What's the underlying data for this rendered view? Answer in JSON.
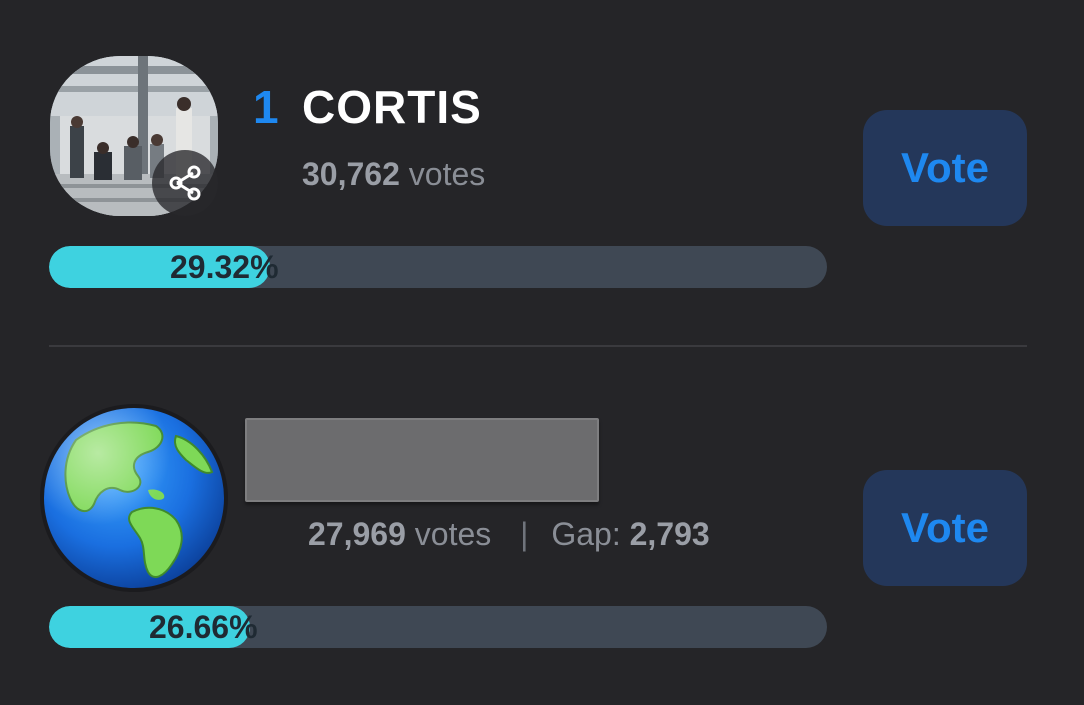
{
  "entries": [
    {
      "rank": "1",
      "name": "CORTIS",
      "votes": "30,762",
      "votes_label": "votes",
      "percent": "29.32%",
      "percent_value": 29.32,
      "vote_label": "Vote",
      "avatar": "group-photo"
    },
    {
      "name_redacted": true,
      "votes": "27,969",
      "votes_label": "votes",
      "separator": "|",
      "gap_label": "Gap:",
      "gap": "2,793",
      "percent": "26.66%",
      "percent_value": 26.66,
      "vote_label": "Vote",
      "avatar": "globe-icon"
    }
  ],
  "icons": {
    "share": "share-icon",
    "globe": "globe-icon"
  },
  "colors": {
    "background": "#252528",
    "accent": "#1e88f0",
    "bar_fill": "#3ed2e0",
    "bar_track": "#3f4854",
    "vote_button_bg": "#24375a"
  }
}
